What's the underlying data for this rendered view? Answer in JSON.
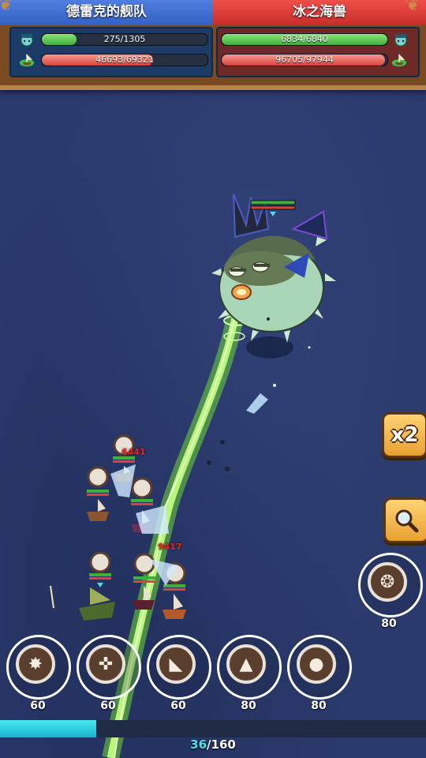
{
  "hud": {
    "left": {
      "team_name": "德雷克的舰队",
      "crew_hp_text": "275/1305",
      "crew_hp_fraction": 0.21,
      "ship_hp_text": "46693/69321",
      "ship_hp_fraction": 0.67,
      "crew_icon": "pirate-head-icon",
      "ship_icon": "ship-icon"
    },
    "right": {
      "team_name": "冰之海兽",
      "crew_hp_text": "6834/6840",
      "crew_hp_fraction": 0.999,
      "ship_hp_text": "96705/97944",
      "ship_hp_fraction": 0.987,
      "crew_icon": "pirate-head-icon",
      "ship_icon": "ship-icon"
    }
  },
  "battle": {
    "damage_numbers": [
      "6441",
      "9417"
    ]
  },
  "side_buttons": {
    "speed_label": "x2",
    "speed_icon": "speed-x2-icon",
    "inspect_icon": "magnifier-icon"
  },
  "skills": [
    {
      "icon": "star-burst-icon",
      "cost": "60"
    },
    {
      "icon": "crosshair-icon",
      "cost": "60"
    },
    {
      "icon": "wolf-head-icon",
      "cost": "60"
    },
    {
      "icon": "shark-fin-icon",
      "cost": "80"
    },
    {
      "icon": "cannonball-icon",
      "cost": "80"
    },
    {
      "icon": "winged-skull-icon",
      "cost": "80"
    }
  ],
  "progress": {
    "current": "36",
    "total": "160",
    "fraction": 0.225
  },
  "colors": {
    "sea": "#2b3a6c",
    "left_team": "#3f6fd6",
    "right_team": "#d93a34",
    "laser": "#8ee64a",
    "progress": "#2fd0e0"
  }
}
